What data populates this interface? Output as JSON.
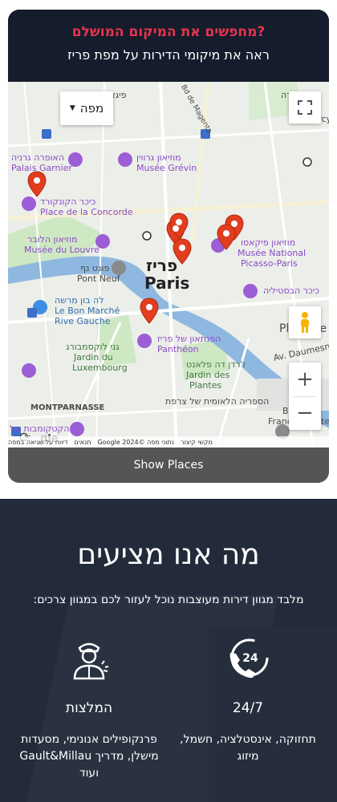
{
  "card": {
    "title": "מחפשים את המיקום המושלם?",
    "subtitle": "ראה את מיקומי הדירות על מפת פריז",
    "show_places": "Show Places"
  },
  "map": {
    "type_label": "מפה",
    "city_he": "פריז",
    "city_en": "Paris",
    "attribution": [
      "מקשי קיצור",
      "נתוני מפה ©2024 Google",
      "תנאים",
      "דיווח על שגיאה במפה"
    ],
    "labels": [
      {
        "text": "פיגאל",
        "cls": ""
      },
      {
        "text": "שערה",
        "cls": ""
      },
      {
        "text": "האופרה גרניה",
        "cls": "poi"
      },
      {
        "text": "Palais Garnier",
        "cls": "poi"
      },
      {
        "text": "מוזיאון גרווין",
        "cls": "poi"
      },
      {
        "text": "Musée Grévin",
        "cls": "poi"
      },
      {
        "text": "כיכר הקונקורד",
        "cls": "poi"
      },
      {
        "text": "Place de la Concorde",
        "cls": "poi"
      },
      {
        "text": "מוזיאון הלובר",
        "cls": "poi"
      },
      {
        "text": "Musée du Louvre",
        "cls": "poi"
      },
      {
        "text": "מוזיאון פיקאסו",
        "cls": "poi"
      },
      {
        "text": "Musée National",
        "cls": "poi"
      },
      {
        "text": "Picasso-Paris",
        "cls": "poi"
      },
      {
        "text": "פונט נף",
        "cls": ""
      },
      {
        "text": "Pont Neuf",
        "cls": ""
      },
      {
        "text": "לה בון מרשה",
        "cls": "blue"
      },
      {
        "text": "Le Bon Marché",
        "cls": "blue"
      },
      {
        "text": "Rive Gauche",
        "cls": "blue"
      },
      {
        "text": "כיכר הבסטיליה",
        "cls": "poi"
      },
      {
        "text": "Place de la",
        "cls": ""
      },
      {
        "text": "הפנתאון של פריז",
        "cls": "poi"
      },
      {
        "text": "Panthéon",
        "cls": "poi"
      },
      {
        "text": "גני לוקסמבורג",
        "cls": "green"
      },
      {
        "text": "Jardin du",
        "cls": "green"
      },
      {
        "text": "Luxembourg",
        "cls": "green"
      },
      {
        "text": "ז'רדן דה פלאנט",
        "cls": "green"
      },
      {
        "text": "Jardin des",
        "cls": "green"
      },
      {
        "text": "Plantes",
        "cls": "green"
      },
      {
        "text": "Av. Daumesnil",
        "cls": ""
      },
      {
        "text": "הספריה הלאומית של צרפת",
        "cls": ""
      },
      {
        "text": "Biblioth",
        "cls": ""
      },
      {
        "text": "François-Mitterr",
        "cls": ""
      },
      {
        "text": "MONTPARNASSE",
        "cls": ""
      },
      {
        "text": "הקטקומבות של",
        "cls": "poi"
      },
      {
        "text": "Bd de Magenta",
        "cls": ""
      },
      {
        "text": "Bercy",
        "cls": ""
      }
    ]
  },
  "offer": {
    "title": "מה אנו מציעים",
    "subtitle": "מלבד מגוון דירות מעוצבות נוכל לעזור לכם במגוון צרכים:",
    "features": [
      {
        "icon": "phone-24-icon",
        "title": "24/7",
        "desc": "תחזוקה, אינסטלציה, חשמל, מיזוג"
      },
      {
        "icon": "concierge-icon",
        "title": "המלצות",
        "desc": "פרנקופילים אנונימי, מסעדות מישלן, מדריך Gault&Millau ועוד"
      }
    ]
  }
}
